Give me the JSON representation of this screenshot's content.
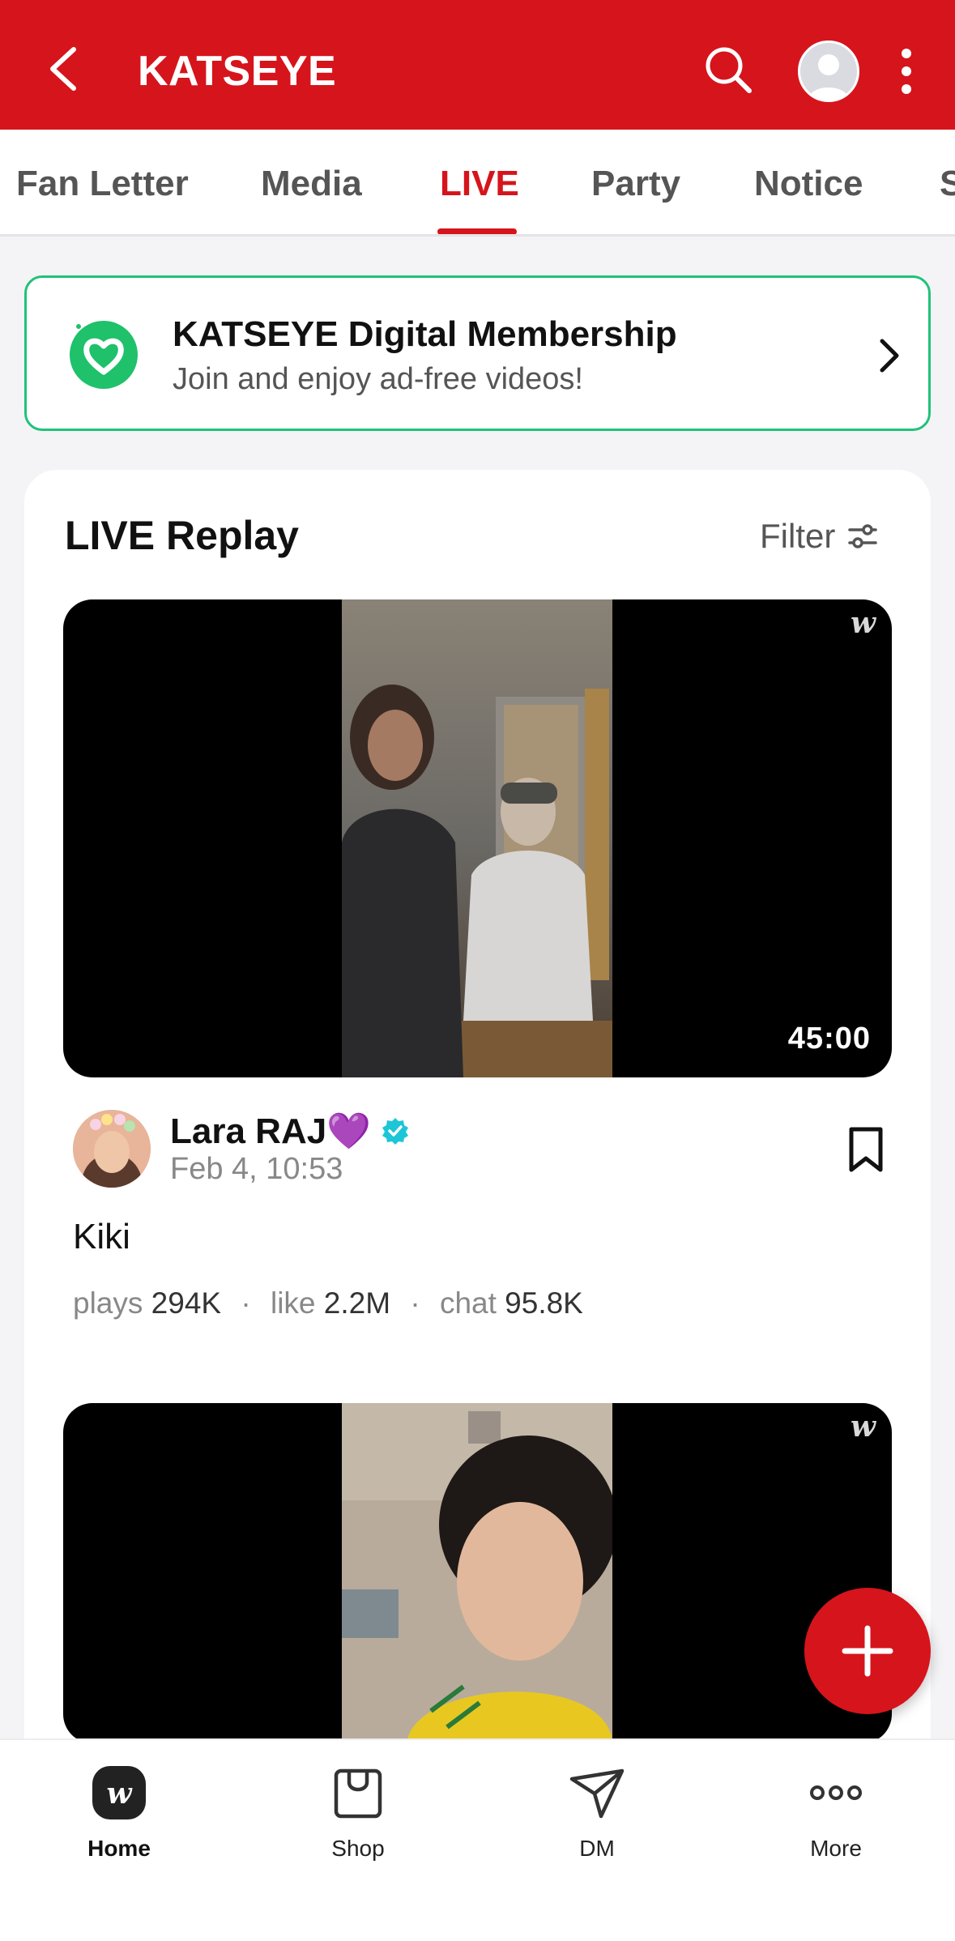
{
  "header": {
    "title": "KATSEYE",
    "brand_color": "#d6141c"
  },
  "tabs": [
    {
      "label": "Fan Letter",
      "active": false
    },
    {
      "label": "Media",
      "active": false
    },
    {
      "label": "LIVE",
      "active": true
    },
    {
      "label": "Party",
      "active": false
    },
    {
      "label": "Notice",
      "active": false
    },
    {
      "label": "S",
      "active": false
    }
  ],
  "membership": {
    "title": "KATSEYE Digital Membership",
    "subtitle": "Join and enjoy ad-free videos!"
  },
  "live_replay": {
    "title": "LIVE Replay",
    "filter_label": "Filter",
    "posts": [
      {
        "duration": "45:00",
        "watermark": "w",
        "author": "Lara RAJ💜",
        "date": "Feb 4, 10:53",
        "title": "Kiki",
        "stats": {
          "plays_label": "plays",
          "plays": "294K",
          "like_label": "like",
          "like": "2.2M",
          "chat_label": "chat",
          "chat": "95.8K"
        }
      },
      {
        "watermark": "w"
      }
    ]
  },
  "bottom_nav": [
    {
      "label": "Home",
      "icon": "weverse-home-icon",
      "active": true
    },
    {
      "label": "Shop",
      "icon": "shopping-bag-icon",
      "active": false
    },
    {
      "label": "DM",
      "icon": "paper-plane-icon",
      "active": false
    },
    {
      "label": "More",
      "icon": "more-dots-icon",
      "active": false
    }
  ]
}
